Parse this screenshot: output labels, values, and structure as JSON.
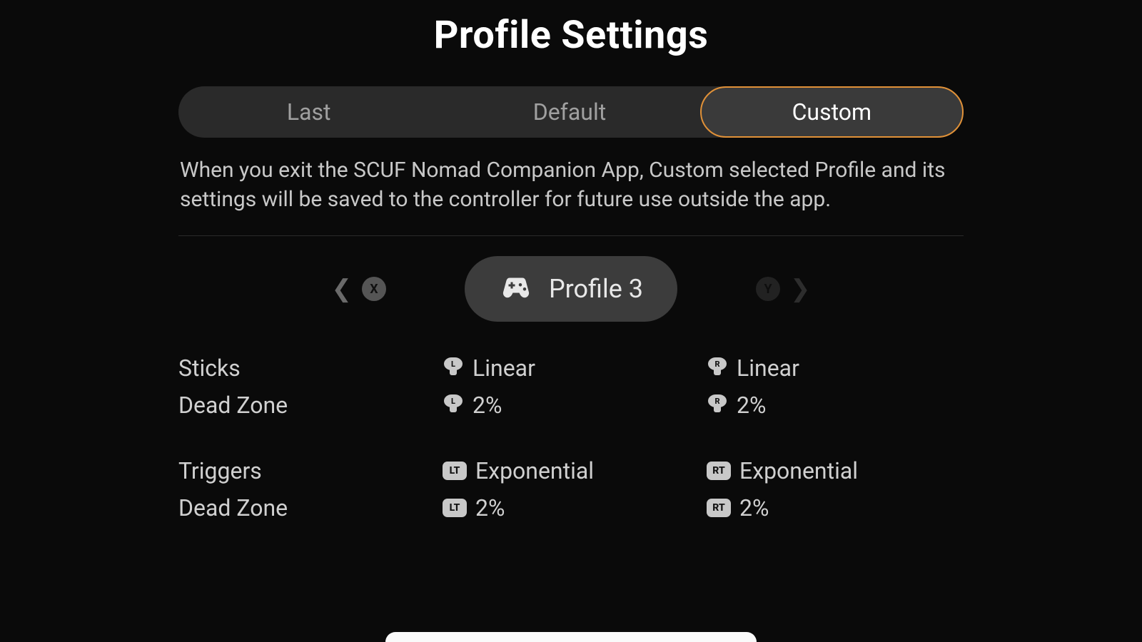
{
  "title": "Profile Settings",
  "tabs": {
    "items": [
      "Last",
      "Default",
      "Custom"
    ],
    "active_index": 2
  },
  "description": "When you exit the SCUF Nomad Companion App, Custom selected Profile and its settings will be saved to the controller for future use outside the app.",
  "profile_selector": {
    "prev_hint": "X",
    "next_hint": "Y",
    "current_name": "Profile 3"
  },
  "settings": {
    "rows": [
      {
        "label": "Sticks",
        "left_badge": "L",
        "left_value": "Linear",
        "right_badge": "R",
        "right_value": "Linear",
        "badge_type": "stick"
      },
      {
        "label": "Dead Zone",
        "left_badge": "L",
        "left_value": "2%",
        "right_badge": "R",
        "right_value": "2%",
        "badge_type": "stick"
      },
      {
        "label": "Triggers",
        "left_badge": "LT",
        "left_value": "Exponential",
        "right_badge": "RT",
        "right_value": "Exponential",
        "badge_type": "trigger"
      },
      {
        "label": "Dead Zone",
        "left_badge": "LT",
        "left_value": "2%",
        "right_badge": "RT",
        "right_value": "2%",
        "badge_type": "trigger"
      }
    ]
  }
}
